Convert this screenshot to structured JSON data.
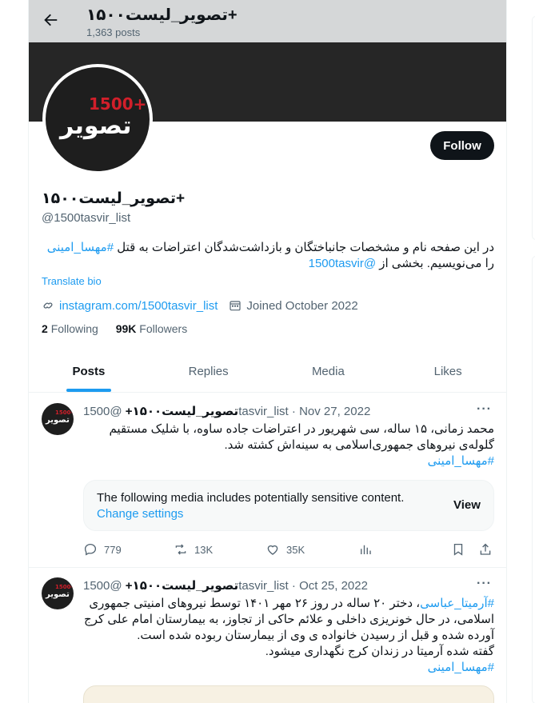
{
  "header": {
    "title": "تصویر_لیست۱۵۰۰+",
    "posts_count": "1,363 posts"
  },
  "profile": {
    "avatar_logo_text": "تصویر",
    "avatar_logo_number": "1500+",
    "follow_label": "Follow",
    "name": "تصویر_لیست۱۵۰۰+",
    "handle": "@1500tasvir_list",
    "bio_text": "در این صفحه نام و مشخصات جانباختگان و بازداشت‌شدگان اعتراضات به قتل ",
    "bio_hashtag": "#مهسا_امینی",
    "bio_text2": " را می‌نویسیم. بخشی از ",
    "bio_mention": "@1500tasvir",
    "translate_label": "Translate bio",
    "website": "instagram.com/1500tasvir_list",
    "joined": "Joined October 2022",
    "following_count": "2",
    "following_label": "Following",
    "followers_count": "99K",
    "followers_label": "Followers"
  },
  "tabs": [
    {
      "label": "Posts",
      "active": true
    },
    {
      "label": "Replies",
      "active": false
    },
    {
      "label": "Media",
      "active": false
    },
    {
      "label": "Likes",
      "active": false
    }
  ],
  "tweets": [
    {
      "name": "تصویر_لیست۱۵۰۰+",
      "handle": "@1500tasvir_list",
      "date": "Nov 27, 2022",
      "text": "محمد زمانی، ۱۵ ساله، سی شهریور در اعتراضات جاده ساوه، با شلیک مستقیم گلوله‌ی نیروهای جمهوری‌اسلامی به سینه‌اش کشته شد.",
      "hashtag": "#مهسا_امینی",
      "sensitive_message": "The following media includes potentially sensitive content.",
      "sensitive_change": "Change settings",
      "sensitive_view": "View",
      "replies": "779",
      "reposts": "13K",
      "likes": "35K"
    },
    {
      "name": "تصویر_لیست۱۵۰۰+",
      "handle": "@1500tasvir_list",
      "date": "Oct 25, 2022",
      "hashtag_start": "#آرمیتا_عباسی",
      "text": "، دختر ۲۰ ساله در روز ۲۶ مهر ۱۴۰۱ توسط نیروهای امنیتی جمهوری اسلامی، در حال خونریزی داخلی و علائم حاکی از تجاوز، به بیمارستان امام علی کرج آورده شده و قبل از رسیدن خانواده ی وی از بیمارستان ربوده شده است.",
      "text2": "گفته شده آرمیتا در زندان کرج نگهداری میشود.",
      "hashtag": "#مهسا_امینی"
    }
  ],
  "colors": {
    "accent": "#1d9bf0",
    "text": "#0f1419",
    "muted": "#536471",
    "banner": "#262626",
    "logo_red": "#d21f2a"
  }
}
